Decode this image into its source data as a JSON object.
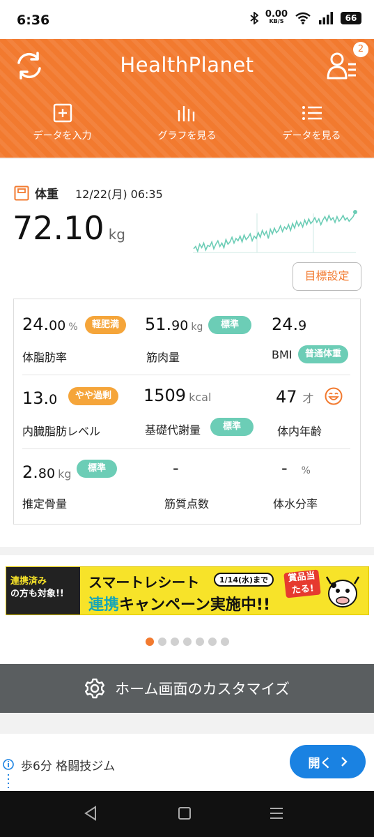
{
  "status_bar": {
    "time": "6:36",
    "net_speed": "0.00",
    "net_unit": "KB/S",
    "battery": "66",
    "icons": [
      "bluetooth-icon",
      "wifi-icon",
      "signal-icon",
      "battery-icon"
    ]
  },
  "header": {
    "app_title": "HealthPlanet",
    "notification_count": "2",
    "bg_color": "#f27a2f",
    "nav": [
      {
        "label": "データを入力",
        "icon": "plus-square-icon"
      },
      {
        "label": "グラフを見る",
        "icon": "bar-graph-icon"
      },
      {
        "label": "データを見る",
        "icon": "list-icon"
      }
    ]
  },
  "weight": {
    "label": "体重",
    "date": "12/22(月) 06:35",
    "value_int": "72.10",
    "unit": "kg",
    "goal_button": "目標設定"
  },
  "metrics": [
    {
      "int": "24.",
      "dec": "00",
      "unit": "%",
      "name": "体脂肪率",
      "badge": "軽肥満",
      "badge_color": "orange"
    },
    {
      "int": "51.",
      "dec": "90",
      "unit": "kg",
      "name": "筋肉量",
      "badge": "標準",
      "badge_color": "teal"
    },
    {
      "int": "24.",
      "dec": "9",
      "unit": "",
      "name": "BMI",
      "badge": "普通体重",
      "badge_color": "teal"
    },
    {
      "int": "13.",
      "dec": "0",
      "unit": "",
      "name": "内臓脂肪レベル",
      "badge": "やや過剰",
      "badge_color": "orange"
    },
    {
      "int": "1509",
      "dec": "",
      "unit": "kcal",
      "name": "基礎代謝量",
      "badge": "標準",
      "badge_color": "teal"
    },
    {
      "int": "47",
      "dec": "",
      "unit": "才",
      "name": "体内年齢",
      "badge": "",
      "badge_color": ""
    },
    {
      "int": "2.",
      "dec": "80",
      "unit": "kg",
      "name": "推定骨量",
      "badge": "標準",
      "badge_color": "teal"
    },
    {
      "int": "-",
      "dec": "",
      "unit": "",
      "name": "筋質点数",
      "badge": "",
      "badge_color": ""
    },
    {
      "int": "-",
      "dec": "",
      "unit": "%",
      "name": "体水分率",
      "badge": "",
      "badge_color": ""
    }
  ],
  "banner": {
    "left_line1": "連携済み",
    "left_line2": "の方も対象!!",
    "title_line1": "スマートレシート",
    "date": "1/14(水)まで",
    "title_line2_a": "連携",
    "title_line2_b": "キャンペーン実施中!!",
    "prize": "賞品当たる!",
    "page_count": 7,
    "active_page": 0
  },
  "customize": {
    "label": "ホーム画面のカスタマイズ",
    "icon": "gear-icon"
  },
  "ad": {
    "text": "歩6分 格闘技ジム",
    "button": "開く"
  },
  "sparkline_data": [
    62,
    60,
    64,
    58,
    61,
    57,
    63,
    59,
    60,
    56,
    62,
    58,
    55,
    60,
    57,
    61,
    54,
    58,
    56,
    52,
    57,
    53,
    55,
    51,
    56,
    50,
    54,
    52,
    49,
    55,
    51,
    53,
    48,
    52,
    46,
    50,
    47,
    53,
    45,
    49,
    44,
    48,
    46,
    42,
    47,
    43,
    45,
    41,
    46,
    40,
    44,
    38,
    42,
    39,
    43,
    37,
    41,
    36,
    40,
    38,
    35,
    39,
    36,
    41,
    37,
    34,
    38,
    33,
    37,
    35,
    39,
    34,
    38,
    36,
    33,
    37,
    35,
    38,
    36,
    34,
    30
  ]
}
